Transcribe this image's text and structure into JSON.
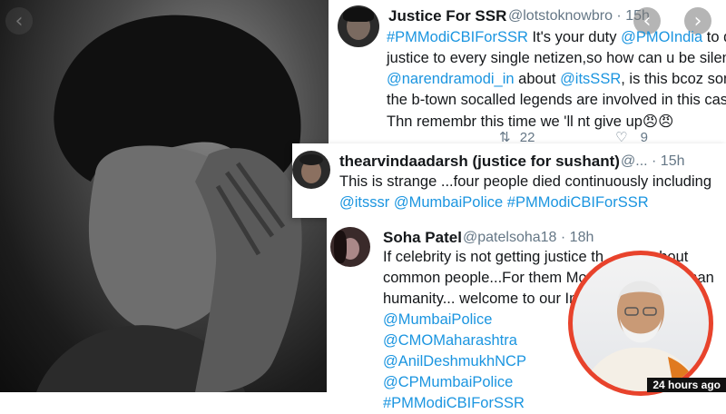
{
  "tweet1": {
    "name": "Justice For SSR",
    "handle": "@lotstoknowbro",
    "time": "15h",
    "line1_a": "#PMModiCBIForSSR",
    "line1_b": " It's your duty ",
    "line1_c": "@PMOIndia",
    "line1_d": " to do",
    "line2": "justice to every single netizen,so how can u be silent",
    "line3_a": "@narendramodi_in",
    "line3_b": " about ",
    "line3_c": "@itsSSR",
    "line3_d": ", is this bcoz some o",
    "line4": "the b-town socalled legends are involved in this case ?",
    "line5": "Thn remembr this time we 'll nt give up",
    "line5_emoji": "😠😠",
    "retweets": "22",
    "likes": "9"
  },
  "tweet2": {
    "name": "thearvindaadarsh (justice for sushant)",
    "handle": "@... · 15h",
    "line1": "This is strange ...four people died continuously including",
    "line2": "@itsssr @MumbaiPolice #PMModiCBIForSSR"
  },
  "tweet3": {
    "name": "Soha Patel",
    "handle": "@patelsoha18",
    "time": "18h",
    "line1_a": "If celebrity is not getting justice th",
    "line1_b": "about",
    "line2_a": "common people...For them Mo",
    "line2_b": "than",
    "line3": "humanity... welcome to our In",
    "mentions": [
      "@MumbaiPolice",
      "@CMOMaharashtra",
      "@AnilDeshmukhNCP",
      "@CPMumbaiPolice",
      "#PMModiCBIForSSR"
    ]
  },
  "nav": {
    "left": "‹",
    "right": "›"
  },
  "timestamp": "24 hours ago",
  "colors": {
    "link": "#1b95e0",
    "ring": "#e8432c"
  },
  "icons": {
    "retweet": "retweet-icon",
    "like": "heart-icon",
    "prev": "chevron-left-icon",
    "next": "chevron-right-icon"
  }
}
